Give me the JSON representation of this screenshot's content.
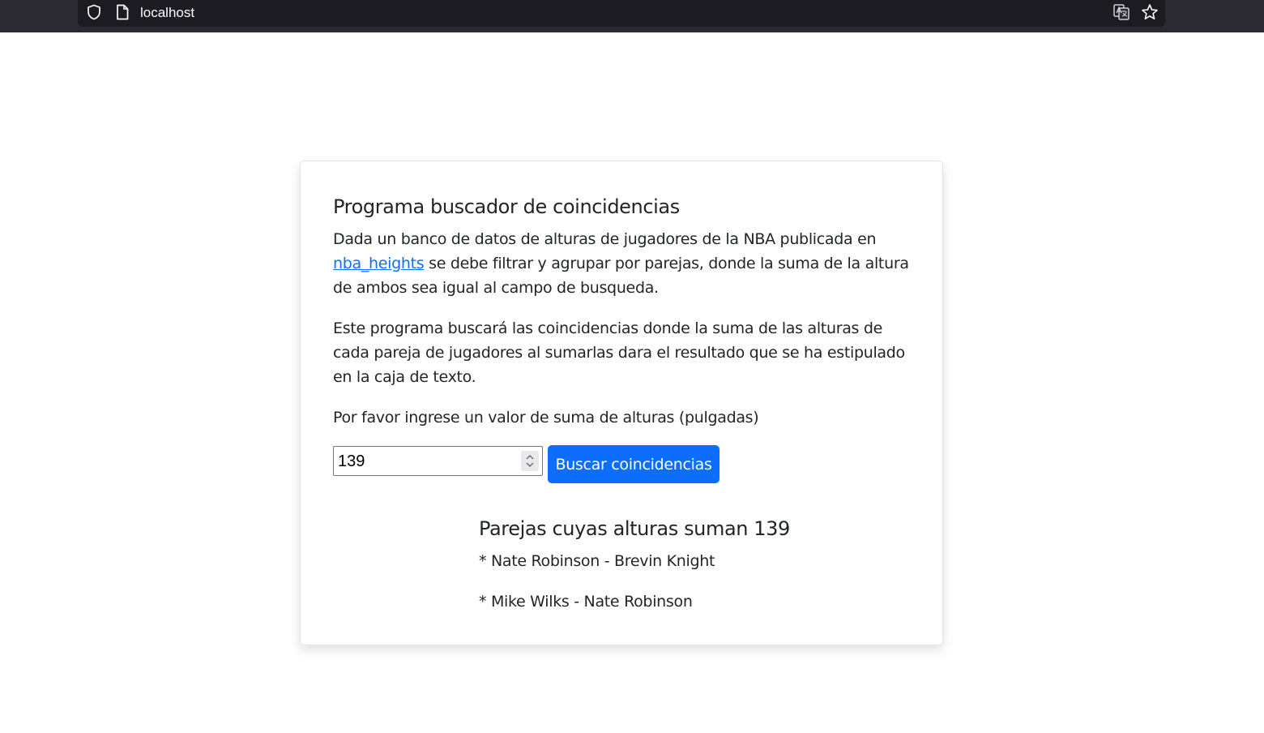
{
  "browser": {
    "url": "localhost",
    "icons": [
      "shield-icon",
      "page-icon",
      "translate-icon",
      "star-icon"
    ]
  },
  "card": {
    "title": "Programa buscador de coincidencias",
    "intro_before_link": "Dada un banco de datos de alturas de jugadores de la NBA publicada en ",
    "link_text": "nba_heights",
    "intro_after_link": " se debe filtrar y agrupar por parejas, donde la suma de la altura de ambos sea igual al campo de busqueda.",
    "description": "Este programa buscará las coincidencias donde la suma de las alturas de cada pareja de jugadores al sumarlas dara el resultado que se ha estipulado en la caja de texto.",
    "prompt": "Por favor ingrese un valor de suma de alturas (pulgadas)",
    "input_value": "139",
    "button_label": "Buscar coincidencias"
  },
  "results": {
    "title": "Parejas cuyas alturas suman 139",
    "pairs": [
      "* Nate Robinson - Brevin Knight",
      "* Mike Wilks - Nate Robinson"
    ]
  },
  "colors": {
    "accent": "#0d6efd",
    "browser_bg": "#2b2a33",
    "text": "#212529"
  }
}
